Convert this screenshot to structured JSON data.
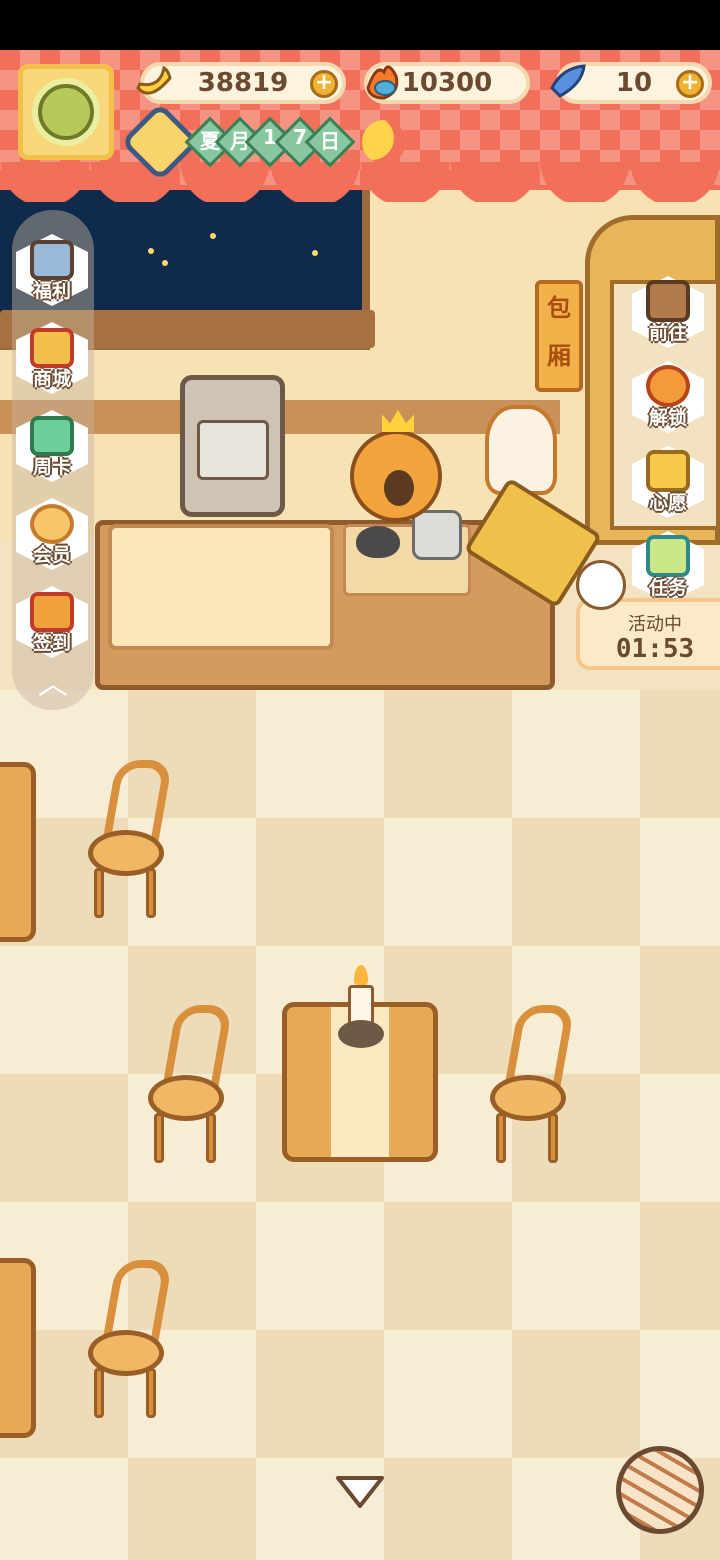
{
  "currencies": {
    "banana": "38819",
    "fire_fish": "10300",
    "blue_fish": "10"
  },
  "calendar": {
    "season": "夏",
    "month": "月",
    "day_tens": "1",
    "day_ones": "7",
    "day_suffix": "日",
    "time_of_day": "night-moon-icon"
  },
  "left_menu": [
    {
      "label": "福利",
      "icon": "tv-gift-icon"
    },
    {
      "label": "商城",
      "icon": "shop-icon"
    },
    {
      "label": "周卡",
      "icon": "weekly-card-icon"
    },
    {
      "label": "会员",
      "icon": "member-badge-icon"
    },
    {
      "label": "签到",
      "icon": "check-in-icon"
    }
  ],
  "right_menu": [
    {
      "label": "前往",
      "icon": "signboard-icon"
    },
    {
      "label": "解锁",
      "icon": "key-icon"
    },
    {
      "label": "心愿",
      "icon": "wish-heart-icon"
    },
    {
      "label": "任务",
      "icon": "task-clipboard-icon"
    }
  ],
  "event": {
    "title": "活动中",
    "timer": "01:53"
  },
  "room_sign": {
    "char1": "包",
    "char2": "厢"
  },
  "colors": {
    "banner": "#f2705a",
    "wall": "#f6e2b3",
    "floor": "#f7ecd4",
    "wood": "#d49a5e"
  }
}
